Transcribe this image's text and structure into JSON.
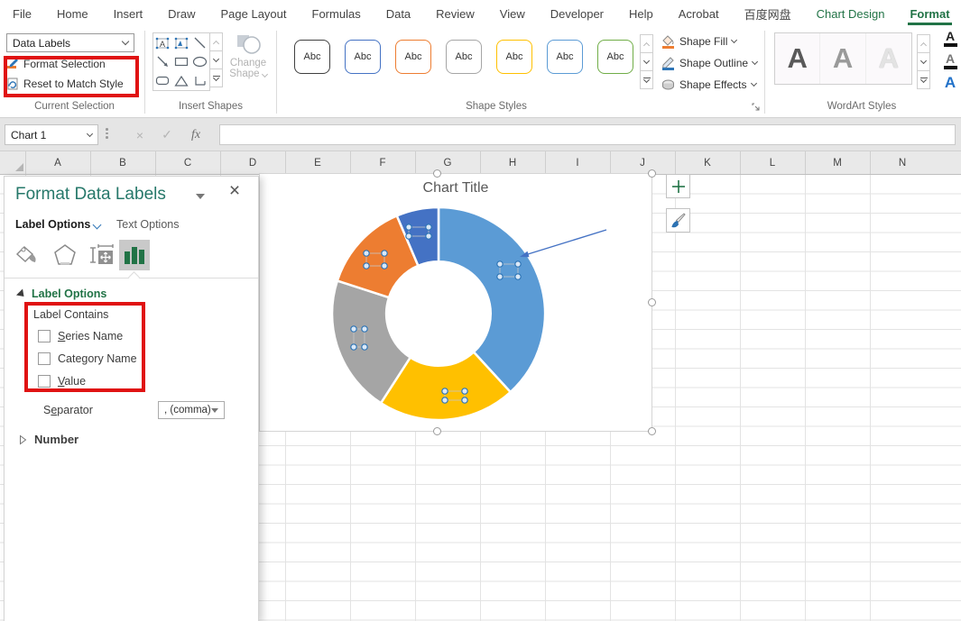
{
  "colors": {
    "green": "#217346",
    "red": "#E01212",
    "pane_title": "#26786A",
    "blue_accent": "#2E75B6"
  },
  "ribbon": {
    "tabs": [
      "File",
      "Home",
      "Insert",
      "Draw",
      "Page Layout",
      "Formulas",
      "Data",
      "Review",
      "View",
      "Developer",
      "Help",
      "Acrobat",
      "百度网盘",
      "Chart Design",
      "Format"
    ],
    "current_selection": {
      "group_label": "Current Selection",
      "selection_dropdown_value": "Data Labels",
      "format_selection_label": "Format Selection",
      "reset_label": "Reset to Match Style"
    },
    "insert_shapes": {
      "group_label": "Insert Shapes",
      "change_shape_line1": "Change",
      "change_shape_line2": "Shape"
    },
    "shape_styles": {
      "group_label": "Shape Styles",
      "swatch_text": "Abc",
      "swatch_colors": [
        "#404040",
        "#4472C4",
        "#ED7D31",
        "#A5A5A5",
        "#FFC000",
        "#5B9BD5",
        "#70AD47"
      ],
      "fill_label": "Shape Fill",
      "outline_label": "Shape Outline",
      "effects_label": "Shape Effects"
    },
    "wordart": {
      "group_label": "WordArt Styles",
      "sample_letter": "A"
    }
  },
  "formula_bar": {
    "name_box_value": "Chart 1",
    "fx_label": "fx",
    "cancel_glyph": "×",
    "enter_glyph": "✓"
  },
  "grid": {
    "columns": [
      "A",
      "B",
      "C",
      "D",
      "E",
      "F",
      "G",
      "H",
      "I",
      "J",
      "K",
      "L",
      "M",
      "N"
    ]
  },
  "pane": {
    "title": "Format Data Labels",
    "tab_label_options": "Label Options",
    "tab_text_options": "Text Options",
    "section_label_options": "Label Options",
    "label_contains": "Label Contains",
    "checkboxes": [
      {
        "pre": "",
        "accel": "S",
        "post": "eries Name",
        "checked": false
      },
      {
        "pre": "Cate",
        "accel": "g",
        "post": "ory Name",
        "checked": false
      },
      {
        "pre": "",
        "accel": "V",
        "post": "alue",
        "checked": false
      }
    ],
    "separator": {
      "pre": "S",
      "accel": "e",
      "post": "parator"
    },
    "separator_value": ", (comma)",
    "number_section": "Number"
  },
  "chart": {
    "title": "Chart Title"
  },
  "chart_data": {
    "type": "pie",
    "subtype": "doughnut",
    "title": "Chart Title",
    "hole_ratio": 0.49,
    "start_angle_deg": 0,
    "direction": "clockwise",
    "legend": "none",
    "slices": [
      {
        "color": "#5B9BD5",
        "percent": 38.2
      },
      {
        "color": "#FFC000",
        "percent": 20.9
      },
      {
        "color": "#A5A5A5",
        "percent": 20.9
      },
      {
        "color": "#ED7D31",
        "percent": 13.6
      },
      {
        "color": "#4472C4",
        "percent": 6.4
      }
    ]
  }
}
